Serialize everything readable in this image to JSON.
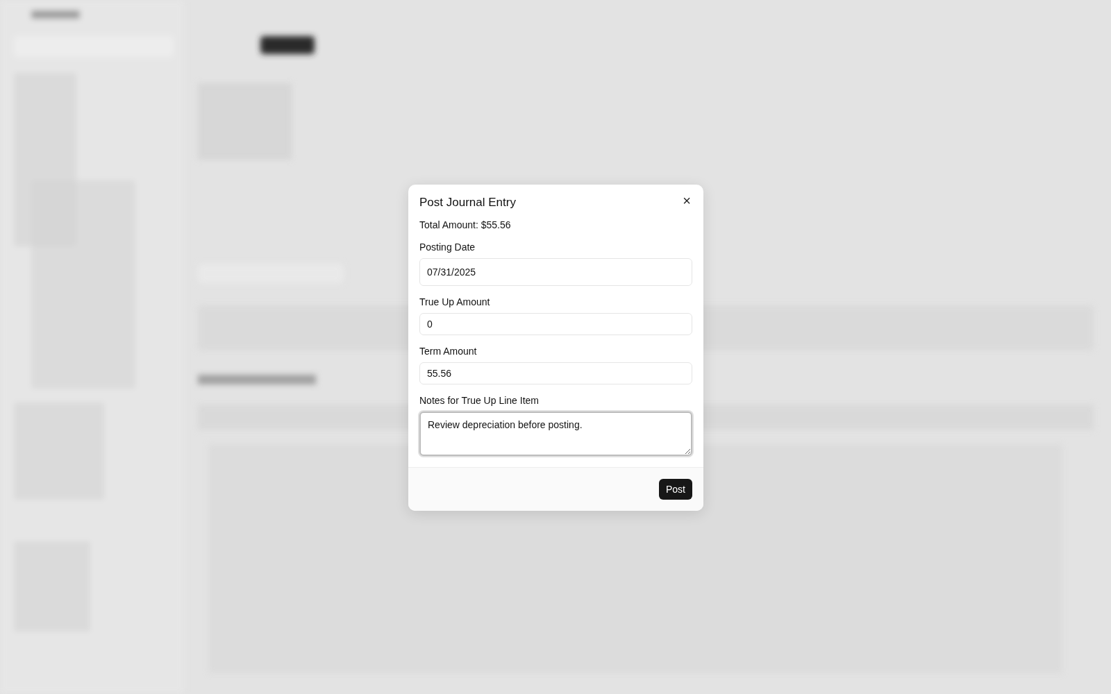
{
  "dialog": {
    "title": "Post Journal Entry",
    "close": "×",
    "total": "Total Amount: $55.56",
    "fields": [
      {
        "kind": "input",
        "label": "Posting Date",
        "value": "07/31/2025",
        "focused": false
      },
      {
        "kind": "input",
        "label": "True Up Amount",
        "value": "0",
        "focused": false
      },
      {
        "kind": "input",
        "label": "Term Amount",
        "value": "55.56",
        "focused": false
      },
      {
        "kind": "textarea",
        "label": "Notes for True Up Line Item",
        "value": "Review depreciation before posting.",
        "focused": true
      }
    ],
    "buttons": [
      "Post"
    ]
  }
}
